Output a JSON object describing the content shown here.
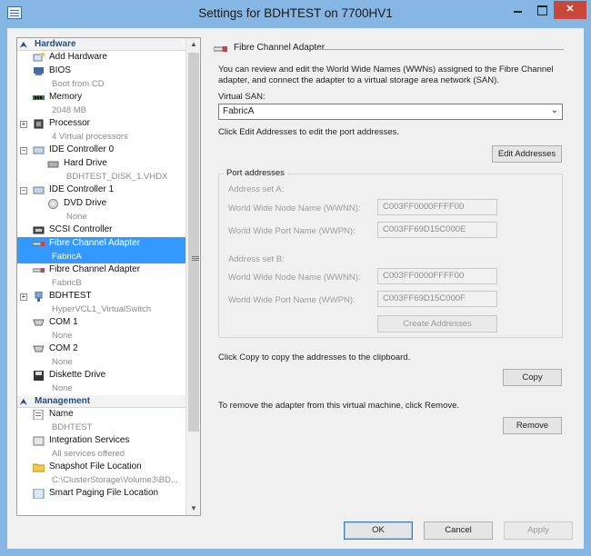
{
  "window": {
    "title": "Settings for BDHTEST on 7700HV1",
    "close_glyph": "✕",
    "min_label": "minimize",
    "max_label": "maximize"
  },
  "tree": {
    "hardware_label": "Hardware",
    "management_label": "Management",
    "hardware_items": [
      {
        "label": "Add Hardware",
        "sub": "",
        "icon": "add-hardware-icon"
      },
      {
        "label": "BIOS",
        "sub": "Boot from CD",
        "icon": "bios-icon"
      },
      {
        "label": "Memory",
        "sub": "2048 MB",
        "icon": "memory-icon"
      },
      {
        "label": "Processor",
        "sub": "4 Virtual processors",
        "icon": "processor-icon"
      },
      {
        "label": "IDE Controller 0",
        "sub": "",
        "icon": "ide-controller-icon"
      },
      {
        "label": "Hard Drive",
        "sub": "BDHTEST_DISK_1.VHDX",
        "icon": "hard-drive-icon"
      },
      {
        "label": "IDE Controller 1",
        "sub": "",
        "icon": "ide-controller-icon"
      },
      {
        "label": "DVD Drive",
        "sub": "None",
        "icon": "dvd-drive-icon"
      },
      {
        "label": "SCSI Controller",
        "sub": "",
        "icon": "scsi-controller-icon"
      },
      {
        "label": "Fibre Channel Adapter",
        "sub": "FabricA",
        "icon": "fibre-channel-icon"
      },
      {
        "label": "Fibre Channel Adapter",
        "sub": "FabricB",
        "icon": "fibre-channel-icon"
      },
      {
        "label": "BDHTEST",
        "sub": "HyperVCL1_VirtualSwitch",
        "icon": "network-adapter-icon"
      },
      {
        "label": "COM 1",
        "sub": "None",
        "icon": "com-port-icon"
      },
      {
        "label": "COM 2",
        "sub": "None",
        "icon": "com-port-icon"
      },
      {
        "label": "Diskette Drive",
        "sub": "None",
        "icon": "diskette-icon"
      }
    ],
    "management_items": [
      {
        "label": "Name",
        "sub": "BDHTEST",
        "icon": "name-icon"
      },
      {
        "label": "Integration Services",
        "sub": "All services offered",
        "icon": "integration-services-icon"
      },
      {
        "label": "Snapshot File Location",
        "sub": "C:\\ClusterStorage\\Volume3\\BD...",
        "icon": "snapshot-folder-icon"
      },
      {
        "label": "Smart Paging File Location",
        "sub": "",
        "icon": "paging-file-icon"
      }
    ]
  },
  "panel": {
    "header": "Fibre Channel Adapter",
    "intro_line1": "You can review and edit the World Wide Names (WWNs) assigned to the Fibre Channel",
    "intro_line2": "adapter, and connect the adapter to a virtual storage area network (SAN).",
    "vsan_label": "Virtual SAN:",
    "vsan_value": "FabricA",
    "edit_hint": "Click Edit Addresses to edit the port addresses.",
    "edit_button": "Edit Addresses",
    "port_addresses_title": "Port addresses",
    "set_a_label": "Address set A:",
    "set_b_label": "Address set B:",
    "wwnn_label": "World Wide Node Name (WWNN):",
    "wwpn_label": "World Wide Port Name (WWPN):",
    "set_a_wwnn": "C003FF0000FFFF00",
    "set_a_wwpn": "C003FF69D15C000E",
    "set_b_wwnn": "C003FF0000FFFF00",
    "set_b_wwpn": "C003FF69D15C000F",
    "create_button": "Create Addresses",
    "copy_hint": "Click Copy to copy the addresses to the clipboard.",
    "copy_button": "Copy",
    "remove_hint": "To remove the adapter from this virtual machine, click Remove.",
    "remove_button": "Remove"
  },
  "footer": {
    "ok": "OK",
    "cancel": "Cancel",
    "apply": "Apply"
  },
  "colors": {
    "titlebar": "#86b6e3",
    "selection": "#3399ff",
    "section_text": "#1f4e8c",
    "close_button": "#c7473a"
  }
}
